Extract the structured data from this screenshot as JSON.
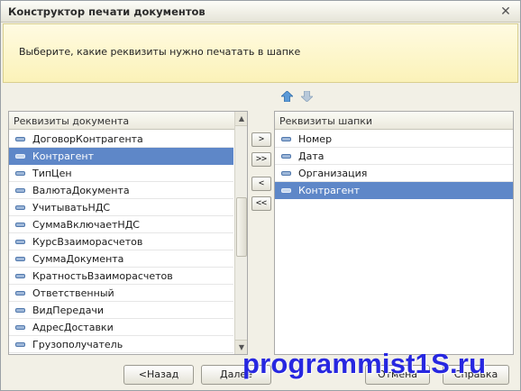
{
  "window": {
    "title": "Конструктор печати документов",
    "close_glyph": "✕"
  },
  "header": {
    "text": "Выберите, какие реквизиты нужно печатать в шапке"
  },
  "order_buttons": {
    "up_icon": "up-arrow-icon",
    "down_icon": "down-arrow-icon"
  },
  "left_panel": {
    "title": "Реквизиты документа",
    "selected_index": 1,
    "items": [
      "ДоговорКонтрагента",
      "Контрагент",
      "ТипЦен",
      "ВалютаДокумента",
      "УчитыватьНДС",
      "СуммаВключаетНДС",
      "КурсВзаиморасчетов",
      "СуммаДокумента",
      "КратностьВзаиморасчетов",
      "Ответственный",
      "ВидПередачи",
      "АдресДоставки",
      "Грузополучатель"
    ]
  },
  "right_panel": {
    "title": "Реквизиты шапки",
    "selected_index": 3,
    "items": [
      "Номер",
      "Дата",
      "Организация",
      "Контрагент"
    ]
  },
  "move_buttons": {
    "add": ">",
    "add_all": ">>",
    "remove": "<",
    "remove_all": "<<"
  },
  "footer": {
    "back": "<Назад",
    "next": "Далее",
    "cancel": "Отмена",
    "help": "Справка"
  },
  "watermark": "programmist1S.ru",
  "colors": {
    "selection": "#5e87c8",
    "header_bg": "#fbf2b8",
    "watermark": "#2727e0"
  }
}
